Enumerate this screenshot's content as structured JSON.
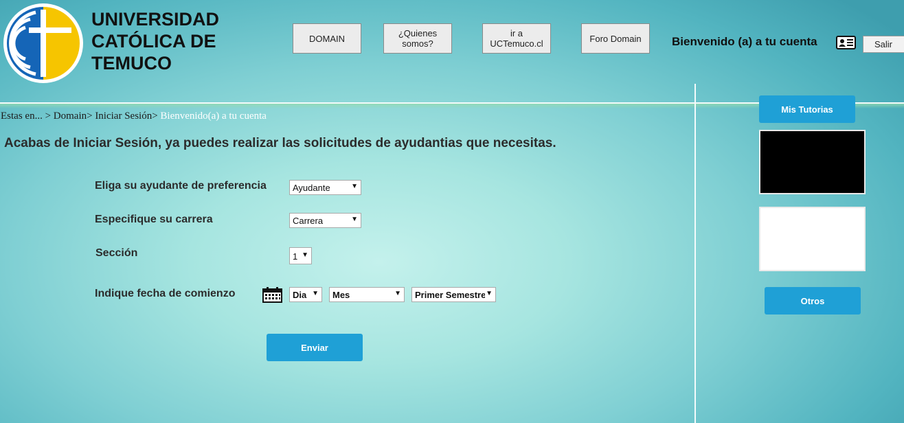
{
  "header": {
    "university_name": "UNIVERSIDAD CATÓLICA DE TEMUCO",
    "nav": [
      {
        "label": "DOMAIN"
      },
      {
        "label": "¿Quienes somos?"
      },
      {
        "label": "ir a UCTemuco.cl"
      },
      {
        "label": "Foro Domain"
      }
    ],
    "welcome": "Bienvenido (a) a tu cuenta",
    "logout_label": "Salir"
  },
  "breadcrumb": {
    "trail": "Estas en... > Domain> Iniciar Sesión> ",
    "current": "Bienvenido(a) a tu cuenta"
  },
  "main": {
    "headline": "Acabas de Iniciar Sesión, ya puedes realizar las solicitudes de ayudantias que necesitas."
  },
  "form": {
    "ayudante_label": "Eliga su ayudante de preferencia",
    "ayudante_value": "Ayudante",
    "carrera_label": "Especifique su carrera",
    "carrera_value": "Carrera",
    "seccion_label": "Sección",
    "seccion_value": "1",
    "fecha_label": "Indique fecha de comienzo",
    "dia_value": "Dia",
    "mes_value": "Mes",
    "semestre_value": "Primer Semestre",
    "submit_label": "Enviar"
  },
  "sidebar": {
    "tutorias_label": "Mis Tutorias",
    "otros_label": "Otros"
  },
  "icons": {
    "logo": "university-logo",
    "id_card": "id-card-icon",
    "calendar": "calendar-icon"
  },
  "colors": {
    "accent_button": "#1fa0d6",
    "logo_blue": "#1565b7",
    "logo_yellow": "#f6c500"
  }
}
